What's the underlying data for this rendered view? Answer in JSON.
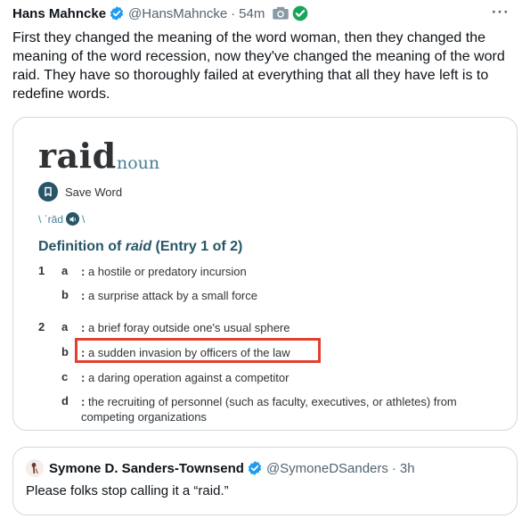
{
  "tweet": {
    "author_name": "Hans Mahncke",
    "handle": "@HansMahncke",
    "separator": "·",
    "time": "54m",
    "more": "···",
    "text": "First they changed the meaning of the word woman, then they changed the meaning of the word recession, now they've changed the meaning of the word raid. They have so thoroughly failed at everything that all they have left is to redefine words."
  },
  "media": {
    "headword": "raid",
    "part_of_speech": "noun",
    "save_word": "Save Word",
    "pron_open": "\\ ˈrād",
    "pron_close": "\\",
    "definition_heading_prefix": "Definition of ",
    "definition_heading_word": "raid",
    "definition_heading_suffix": " (Entry 1 of 2)",
    "senses": [
      {
        "num": "1",
        "letter": "a",
        "text": "a hostile or predatory incursion"
      },
      {
        "num": "",
        "letter": "b",
        "text": "a surprise attack by a small force"
      },
      {
        "num": "2",
        "letter": "a",
        "text": "a brief foray outside one's usual sphere"
      },
      {
        "num": "",
        "letter": "b",
        "text": "a sudden invasion by officers of the law"
      },
      {
        "num": "",
        "letter": "c",
        "text": "a daring operation against a competitor"
      },
      {
        "num": "",
        "letter": "d",
        "text": "the recruiting of personnel (such as faculty, executives, or athletes) from competing organizations"
      }
    ],
    "colon": ":",
    "highlight_color": "#e0402d"
  },
  "quote": {
    "author_name": "Symone D. Sanders-Townsend",
    "handle": "@SymoneDSanders",
    "separator": "·",
    "time": "3h",
    "text": "Please folks stop calling it a “raid.”"
  },
  "colors": {
    "verified": "#1d9bf0",
    "dict_accent": "#265667",
    "muted": "#536471",
    "border": "#cfd9de"
  },
  "icons": [
    "verified-badge-icon",
    "camera-icon",
    "check-circle-icon",
    "more-icon",
    "bookmark-icon",
    "speaker-icon",
    "avatar"
  ]
}
